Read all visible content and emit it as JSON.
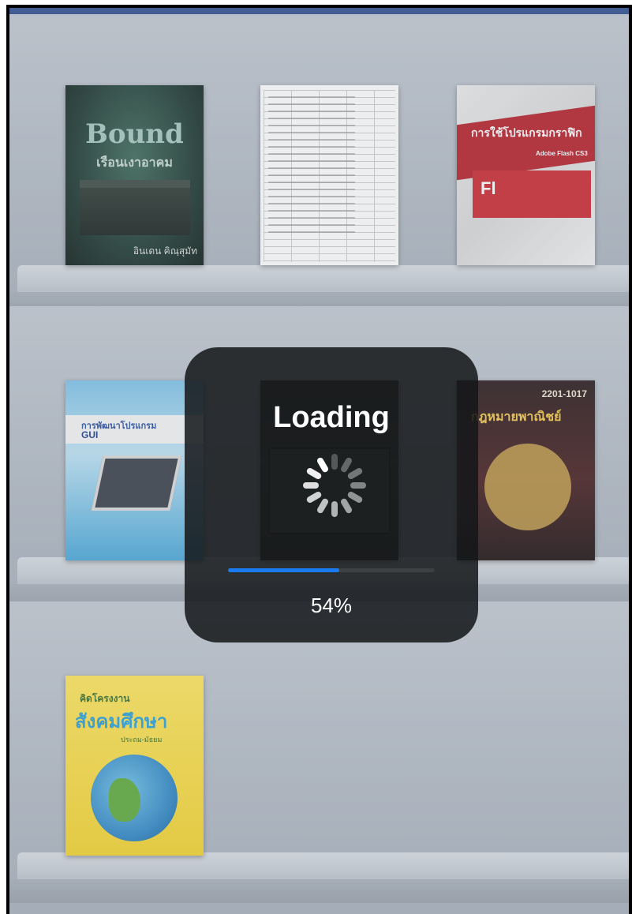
{
  "shelves": {
    "books": [
      {
        "title": "Bound",
        "subtitle": "เรือนเงาอาคม",
        "author": "อินเดน คิณฺสุมัท"
      },
      {
        "title": ""
      },
      {
        "title": "การใช้โปรแกรมกราฟิก",
        "subtitle": "Adobe Flash CS3",
        "badge": "Fl"
      },
      {
        "title": "การพัฒนาโปรแกรม",
        "subtitle": "GUI"
      },
      {
        "title": ""
      },
      {
        "code": "2201-1017",
        "title": "กฎหมายพาณิชย์"
      },
      {
        "title": "สังคมศึกษา",
        "kicker": "คิดโครงงาน",
        "subtitle": "ประถม-มัธยม"
      }
    ]
  },
  "loading": {
    "label": "Loading",
    "progress": 0.54,
    "percent_text": "54%"
  },
  "colors": {
    "accent": "#1a7af0",
    "hud_bg": "#141618",
    "topbar": "#2f4f8f"
  }
}
